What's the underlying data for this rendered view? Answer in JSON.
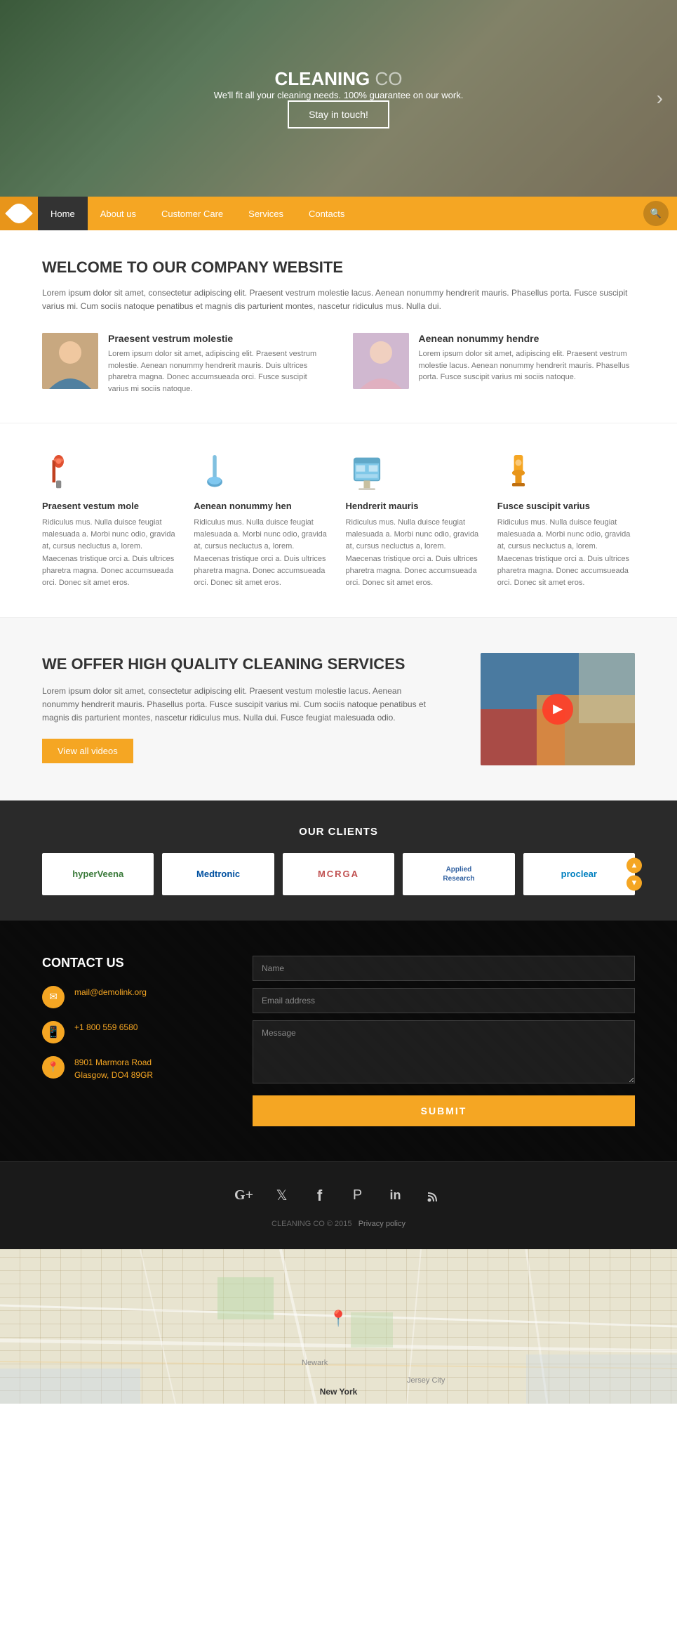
{
  "hero": {
    "title": "CLEANING",
    "title_suffix": " CO",
    "subtitle": "We'll fit all your cleaning needs. 100% guarantee on our work.",
    "cta_label": "Stay in touch!"
  },
  "nav": {
    "items": [
      {
        "label": "Home",
        "active": true
      },
      {
        "label": "About us",
        "active": false
      },
      {
        "label": "Customer Care",
        "active": false
      },
      {
        "label": "Services",
        "active": false
      },
      {
        "label": "Contacts",
        "active": false
      }
    ]
  },
  "welcome": {
    "title": "WELCOME TO OUR COMPANY WEBSITE",
    "intro": "Lorem ipsum dolor sit amet, consectetur adipiscing elit. Praesent vestrum molestie lacus. Aenean nonummy hendrerit mauris. Phasellus porta. Fusce suscipit varius mi. Cum sociis natoque penatibus et magnis dis parturient montes, nascetur ridiculus mus. Nulla dui.",
    "cards": [
      {
        "title": "Praesent vestrum molestie",
        "text": "Lorem ipsum dolor sit amet, adipiscing elit. Praesent vestrum molestie. Aenean nonummy hendrerit mauris. Duis ultrices pharetra magna. Donec accumsueada orci. Fusce suscipit varius mi sociis natoque.",
        "img_type": "man"
      },
      {
        "title": "Aenean nonummy hendre",
        "text": "Lorem ipsum dolor sit amet, adipiscing elit. Praesent vestrum molestie lacus. Aenean nonummy hendrerit mauris. Phasellus porta. Fusce suscipit varius mi sociis natoque.",
        "img_type": "woman"
      }
    ]
  },
  "services": {
    "items": [
      {
        "title": "Praesent vestum mole",
        "text": "Ridiculus mus. Nulla duisce feugiat malesuada a. Morbi nunc odio, gravida at, cursus necluctus a, lorem. Maecenas tristique orci a. Duis ultrices pharetra magna. Donec accumsueada orci. Donec sit amet eros.",
        "icon": "🔴"
      },
      {
        "title": "Aenean nonummy hen",
        "text": "Ridiculus mus. Nulla duisce feugiat malesuada a. Morbi nunc odio, gravida at, cursus necluctus a, lorem. Maecenas tristique orci a. Duis ultrices pharetra magna. Donec accumsueada orci. Donec sit amet eros.",
        "icon": "🔵"
      },
      {
        "title": "Hendrerit mauris",
        "text": "Ridiculus mus. Nulla duisce feugiat malesuada a. Morbi nunc odio, gravida at, cursus necluctus a, lorem. Maecenas tristique orci a. Duis ultrices pharetra magna. Donec accumsueada orci. Donec sit amet eros.",
        "icon": "🟡"
      },
      {
        "title": "Fusce suscipit varius",
        "text": "Ridiculus mus. Nulla duisce feugiat malesuada a. Morbi nunc odio, gravida at, cursus necluctus a, lorem. Maecenas tristique orci a. Duis ultrices pharetra magna. Donec accumsueada orci. Donec sit amet eros.",
        "icon": "🟠"
      }
    ]
  },
  "video": {
    "title": "WE OFFER HIGH QUALITY CLEANING SERVICES",
    "text": "Lorem ipsum dolor sit amet, consectetur adipiscing elit. Praesent vestum molestie lacus. Aenean nonummy hendrerit mauris. Phasellus porta. Fusce suscipit varius mi. Cum sociis natoque penatibus et magnis dis parturient montes, nascetur ridiculus mus. Nulla dui. Fusce feugiat malesuada odio.",
    "btn_label": "View all videos"
  },
  "clients": {
    "title": "OUR CLIENTS",
    "logos": [
      {
        "name": "HyperVeena",
        "class": "hyperveena",
        "symbol": "hyperVeena"
      },
      {
        "name": "Medtronic",
        "class": "medtronic",
        "symbol": "Medtronic"
      },
      {
        "name": "MCRA",
        "class": "mcra",
        "symbol": "MCRGA"
      },
      {
        "name": "Applied Research",
        "class": "applied",
        "symbol": "Applied\nResearch"
      },
      {
        "name": "Proclear",
        "class": "proclear",
        "symbol": "proclear"
      }
    ]
  },
  "contact": {
    "title": "CONTACT US",
    "items": [
      {
        "icon": "✉",
        "text": "mail@demolink.org"
      },
      {
        "icon": "📱",
        "text": "+1 800 559 6580"
      },
      {
        "icon": "📍",
        "text": "8901 Marmora Road\nGlasgow, DO4 89GR"
      }
    ],
    "form": {
      "name_placeholder": "Name",
      "email_placeholder": "Email address",
      "message_placeholder": "Message",
      "submit_label": "SUBMIT"
    }
  },
  "footer": {
    "social_icons": [
      "G+",
      "🐦",
      "f",
      "P",
      "in",
      "RSS"
    ],
    "social_labels": [
      "google-plus",
      "twitter",
      "facebook",
      "pinterest",
      "linkedin",
      "rss"
    ],
    "copyright": "CLEANING CO © 2015",
    "privacy": "Privacy policy"
  },
  "map": {
    "label": "New York"
  }
}
